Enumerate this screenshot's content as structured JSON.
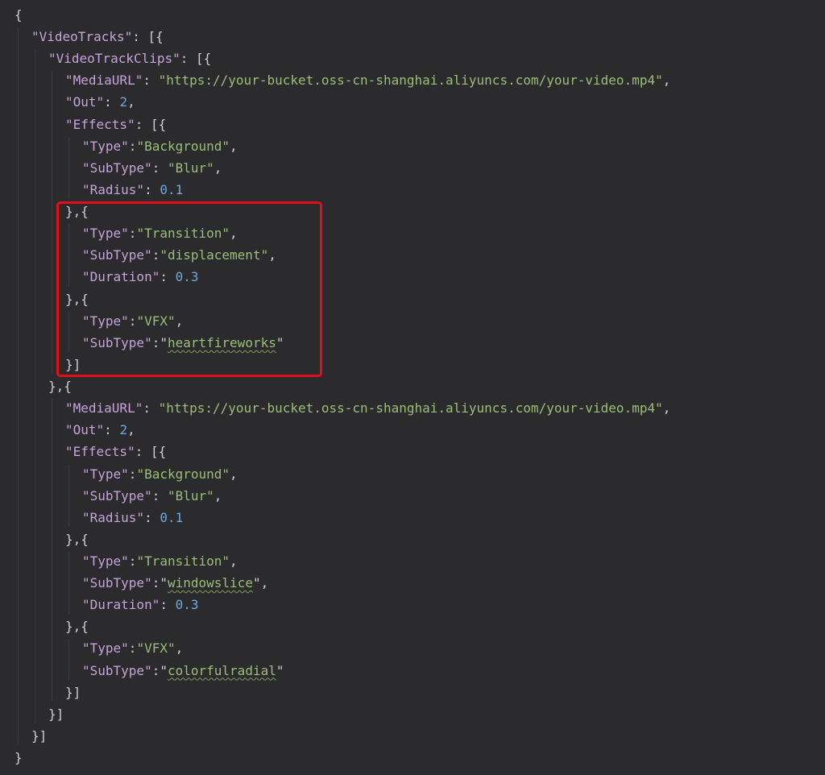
{
  "editor": {
    "colors": {
      "background": "#2b2b2d",
      "punctuation": "#cfcfcf",
      "key": "#c6a3d9",
      "string": "#9bbf78",
      "number": "#6da8e0",
      "highlight_border": "#e0101a"
    },
    "lines": [
      {
        "indent": 0,
        "tokens": [
          {
            "t": "p",
            "v": "{"
          }
        ]
      },
      {
        "indent": 1,
        "tokens": [
          {
            "t": "k",
            "v": "\"VideoTracks\""
          },
          {
            "t": "p",
            "v": ": [{"
          }
        ]
      },
      {
        "indent": 2,
        "tokens": [
          {
            "t": "k",
            "v": "\"VideoTrackClips\""
          },
          {
            "t": "p",
            "v": ": [{"
          }
        ]
      },
      {
        "indent": 3,
        "tokens": [
          {
            "t": "k",
            "v": "\"MediaURL\""
          },
          {
            "t": "p",
            "v": ": "
          },
          {
            "t": "s",
            "v": "\"https://your-bucket.oss-cn-shanghai.aliyuncs.com/your-video.mp4\""
          },
          {
            "t": "p",
            "v": ","
          }
        ]
      },
      {
        "indent": 3,
        "tokens": [
          {
            "t": "k",
            "v": "\"Out\""
          },
          {
            "t": "p",
            "v": ": "
          },
          {
            "t": "n",
            "v": "2"
          },
          {
            "t": "p",
            "v": ","
          }
        ]
      },
      {
        "indent": 3,
        "tokens": [
          {
            "t": "k",
            "v": "\"Effects\""
          },
          {
            "t": "p",
            "v": ": [{"
          }
        ]
      },
      {
        "indent": 4,
        "tokens": [
          {
            "t": "k",
            "v": "\"Type\""
          },
          {
            "t": "p",
            "v": ":"
          },
          {
            "t": "s",
            "v": "\"Background\""
          },
          {
            "t": "p",
            "v": ","
          }
        ]
      },
      {
        "indent": 4,
        "tokens": [
          {
            "t": "k",
            "v": "\"SubType\""
          },
          {
            "t": "p",
            "v": ": "
          },
          {
            "t": "s",
            "v": "\"Blur\""
          },
          {
            "t": "p",
            "v": ","
          }
        ]
      },
      {
        "indent": 4,
        "tokens": [
          {
            "t": "k",
            "v": "\"Radius\""
          },
          {
            "t": "p",
            "v": ": "
          },
          {
            "t": "n",
            "v": "0.1"
          }
        ]
      },
      {
        "indent": 3,
        "tokens": [
          {
            "t": "p",
            "v": "},{"
          }
        ]
      },
      {
        "indent": 4,
        "tokens": [
          {
            "t": "k",
            "v": "\"Type\""
          },
          {
            "t": "p",
            "v": ":"
          },
          {
            "t": "s",
            "v": "\"Transition\""
          },
          {
            "t": "p",
            "v": ","
          }
        ]
      },
      {
        "indent": 4,
        "tokens": [
          {
            "t": "k",
            "v": "\"SubType\""
          },
          {
            "t": "p",
            "v": ":"
          },
          {
            "t": "s",
            "v": "\"displacement\""
          },
          {
            "t": "p",
            "v": ","
          }
        ]
      },
      {
        "indent": 4,
        "tokens": [
          {
            "t": "k",
            "v": "\"Duration\""
          },
          {
            "t": "p",
            "v": ": "
          },
          {
            "t": "n",
            "v": "0.3"
          }
        ]
      },
      {
        "indent": 3,
        "tokens": [
          {
            "t": "p",
            "v": "},{"
          }
        ]
      },
      {
        "indent": 4,
        "tokens": [
          {
            "t": "k",
            "v": "\"Type\""
          },
          {
            "t": "p",
            "v": ":"
          },
          {
            "t": "s",
            "v": "\"VFX\""
          },
          {
            "t": "p",
            "v": ","
          }
        ]
      },
      {
        "indent": 4,
        "tokens": [
          {
            "t": "k",
            "v": "\"SubType\""
          },
          {
            "t": "p",
            "v": ":"
          },
          {
            "t": "p",
            "v": "\""
          },
          {
            "t": "sq",
            "v": "heartfireworks"
          },
          {
            "t": "p",
            "v": "\""
          }
        ]
      },
      {
        "indent": 3,
        "tokens": [
          {
            "t": "p",
            "v": "}]"
          }
        ]
      },
      {
        "indent": 2,
        "tokens": [
          {
            "t": "p",
            "v": "},{"
          }
        ]
      },
      {
        "indent": 3,
        "tokens": [
          {
            "t": "k",
            "v": "\"MediaURL\""
          },
          {
            "t": "p",
            "v": ": "
          },
          {
            "t": "s",
            "v": "\"https://your-bucket.oss-cn-shanghai.aliyuncs.com/your-video.mp4\""
          },
          {
            "t": "p",
            "v": ","
          }
        ]
      },
      {
        "indent": 3,
        "tokens": [
          {
            "t": "k",
            "v": "\"Out\""
          },
          {
            "t": "p",
            "v": ": "
          },
          {
            "t": "n",
            "v": "2"
          },
          {
            "t": "p",
            "v": ","
          }
        ]
      },
      {
        "indent": 3,
        "tokens": [
          {
            "t": "k",
            "v": "\"Effects\""
          },
          {
            "t": "p",
            "v": ": [{"
          }
        ]
      },
      {
        "indent": 4,
        "tokens": [
          {
            "t": "k",
            "v": "\"Type\""
          },
          {
            "t": "p",
            "v": ":"
          },
          {
            "t": "s",
            "v": "\"Background\""
          },
          {
            "t": "p",
            "v": ","
          }
        ]
      },
      {
        "indent": 4,
        "tokens": [
          {
            "t": "k",
            "v": "\"SubType\""
          },
          {
            "t": "p",
            "v": ": "
          },
          {
            "t": "s",
            "v": "\"Blur\""
          },
          {
            "t": "p",
            "v": ","
          }
        ]
      },
      {
        "indent": 4,
        "tokens": [
          {
            "t": "k",
            "v": "\"Radius\""
          },
          {
            "t": "p",
            "v": ": "
          },
          {
            "t": "n",
            "v": "0.1"
          }
        ]
      },
      {
        "indent": 3,
        "tokens": [
          {
            "t": "p",
            "v": "},{"
          }
        ]
      },
      {
        "indent": 4,
        "tokens": [
          {
            "t": "k",
            "v": "\"Type\""
          },
          {
            "t": "p",
            "v": ":"
          },
          {
            "t": "s",
            "v": "\"Transition\""
          },
          {
            "t": "p",
            "v": ","
          }
        ]
      },
      {
        "indent": 4,
        "tokens": [
          {
            "t": "k",
            "v": "\"SubType\""
          },
          {
            "t": "p",
            "v": ":"
          },
          {
            "t": "p",
            "v": "\""
          },
          {
            "t": "sq",
            "v": "windowslice"
          },
          {
            "t": "p",
            "v": "\","
          }
        ]
      },
      {
        "indent": 4,
        "tokens": [
          {
            "t": "k",
            "v": "\"Duration\""
          },
          {
            "t": "p",
            "v": ": "
          },
          {
            "t": "n",
            "v": "0.3"
          }
        ]
      },
      {
        "indent": 3,
        "tokens": [
          {
            "t": "p",
            "v": "},{"
          }
        ]
      },
      {
        "indent": 4,
        "tokens": [
          {
            "t": "k",
            "v": "\"Type\""
          },
          {
            "t": "p",
            "v": ":"
          },
          {
            "t": "s",
            "v": "\"VFX\""
          },
          {
            "t": "p",
            "v": ","
          }
        ]
      },
      {
        "indent": 4,
        "tokens": [
          {
            "t": "k",
            "v": "\"SubType\""
          },
          {
            "t": "p",
            "v": ":"
          },
          {
            "t": "p",
            "v": "\""
          },
          {
            "t": "sq",
            "v": "colorfulradial"
          },
          {
            "t": "p",
            "v": "\""
          }
        ]
      },
      {
        "indent": 3,
        "tokens": [
          {
            "t": "p",
            "v": "}]"
          }
        ]
      },
      {
        "indent": 2,
        "tokens": [
          {
            "t": "p",
            "v": "}]"
          }
        ]
      },
      {
        "indent": 1,
        "tokens": [
          {
            "t": "p",
            "v": "}]"
          }
        ]
      },
      {
        "indent": 0,
        "tokens": [
          {
            "t": "p",
            "v": "}"
          }
        ]
      }
    ]
  }
}
